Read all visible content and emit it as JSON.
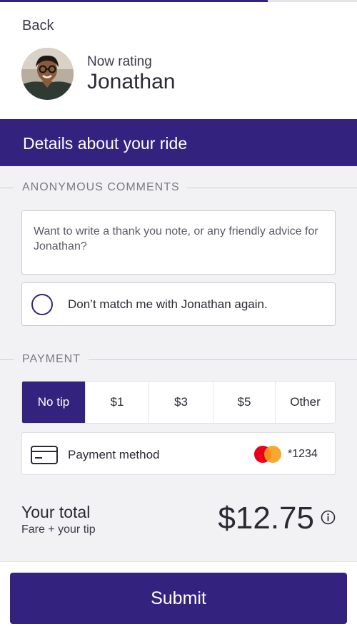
{
  "progress": {
    "fraction": 0.75
  },
  "header": {
    "back_label": "Back",
    "now_rating_label": "Now rating",
    "driver_name": "Jonathan"
  },
  "details": {
    "title": "Details about your ride"
  },
  "comments": {
    "section_label": "ANONYMOUS COMMENTS",
    "placeholder": "Want to write a thank you note, or any friendly advice for Jonathan?"
  },
  "rematch": {
    "label": "Don’t match me with Jonathan again.",
    "checked": false
  },
  "payment": {
    "section_label": "PAYMENT",
    "tips": [
      {
        "label": "No tip",
        "selected": true
      },
      {
        "label": "$1",
        "selected": false
      },
      {
        "label": "$3",
        "selected": false
      },
      {
        "label": "$5",
        "selected": false
      },
      {
        "label": "Other",
        "selected": false
      }
    ],
    "method_label": "Payment method",
    "card_last4": "*1234",
    "card_brand_icon": "mastercard-icon"
  },
  "total": {
    "label": "Your total",
    "sub_label": "Fare + your tip",
    "amount": "$12.75"
  },
  "footer": {
    "submit_label": "Submit"
  },
  "colors": {
    "brand": "#33237f",
    "background": "#f2f2f5",
    "mastercard_red": "#eb001b",
    "mastercard_orange": "#f79e1b"
  }
}
